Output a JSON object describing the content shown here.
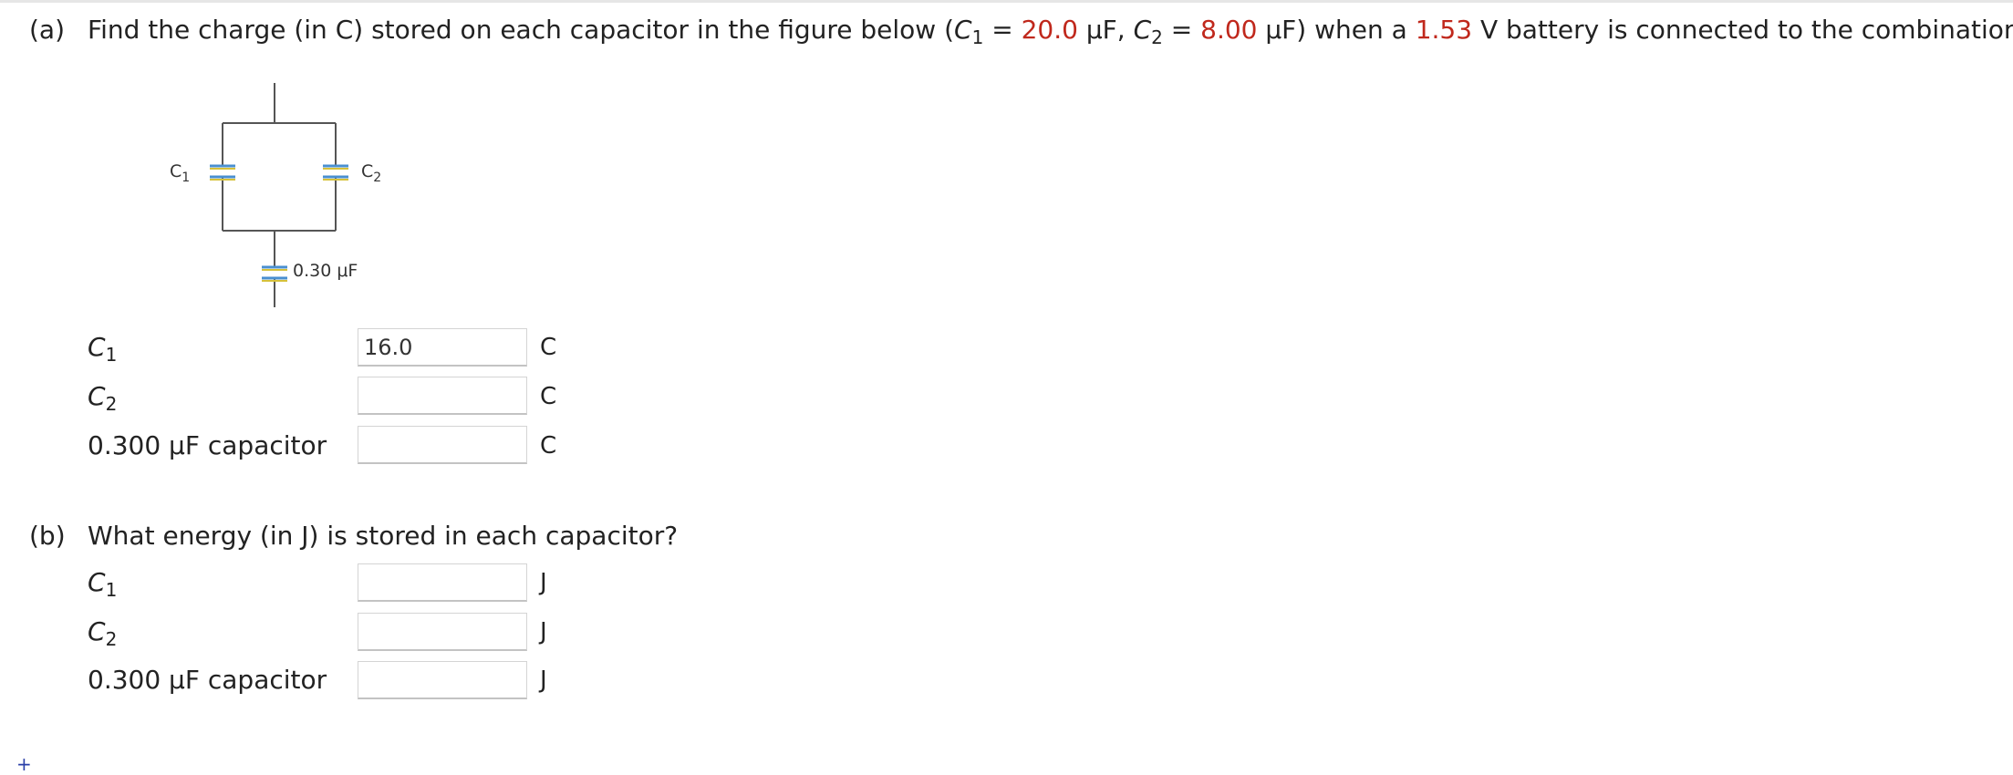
{
  "part_a": {
    "label": "(a)",
    "text_1": "Find the charge (in C) stored on each capacitor in the figure below (",
    "c1_symbol": "C",
    "c1_sub": "1",
    "eq1": " = ",
    "c1_value": "20.0",
    "unit_sep_1": " μF, ",
    "c2_symbol": "C",
    "c2_sub": "2",
    "eq2": " = ",
    "c2_value": "8.00",
    "text_2": " μF) when a ",
    "voltage_value": "1.53",
    "text_3": " V battery is connected to the combination.",
    "rows": [
      {
        "label_symbol": "C",
        "label_sub": "1",
        "label_text": "",
        "value": "16.0",
        "unit": "C"
      },
      {
        "label_symbol": "C",
        "label_sub": "2",
        "label_text": "",
        "value": "",
        "unit": "C"
      },
      {
        "label_symbol": "",
        "label_sub": "",
        "label_text": "0.300 μF capacitor",
        "value": "",
        "unit": "C"
      }
    ]
  },
  "figure": {
    "c1_label": "C",
    "c1_sub": "1",
    "c2_label": "C",
    "c2_sub": "2",
    "c3_label": "0.30 μF"
  },
  "part_b": {
    "label": "(b)",
    "text": "What energy (in J) is stored in each capacitor?",
    "rows": [
      {
        "label_symbol": "C",
        "label_sub": "1",
        "label_text": "",
        "value": "",
        "unit": "J"
      },
      {
        "label_symbol": "C",
        "label_sub": "2",
        "label_text": "",
        "value": "",
        "unit": "J"
      },
      {
        "label_symbol": "",
        "label_sub": "",
        "label_text": "0.300 μF capacitor",
        "value": "",
        "unit": "J"
      }
    ]
  },
  "footer": {
    "plus": "+"
  },
  "colors": {
    "highlight": "#c0281c",
    "plate_blue": "#4a8fd0",
    "plate_yellow": "#d6c13a"
  }
}
